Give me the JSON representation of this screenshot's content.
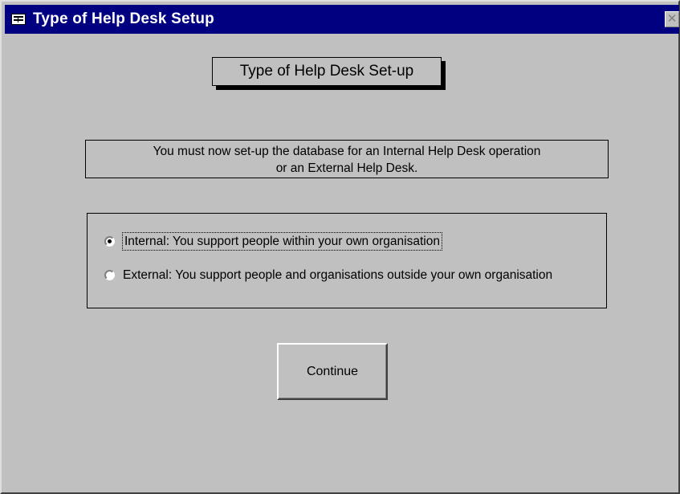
{
  "window": {
    "title": "Type of Help Desk Setup",
    "title_icon": "form-icon",
    "close_glyph": "✕",
    "colors": {
      "titlebar": "#000080",
      "face": "#c0c0c0"
    }
  },
  "heading": "Type of Help Desk Set-up",
  "info": {
    "line1": "You must now set-up the database for an Internal Help Desk operation",
    "line2": "or an External Help Desk."
  },
  "options": [
    {
      "label": "Internal: You support people within your own organisation",
      "selected": true
    },
    {
      "label": "External: You support people and organisations outside your own organisation",
      "selected": false
    }
  ],
  "continue_label": "Continue"
}
